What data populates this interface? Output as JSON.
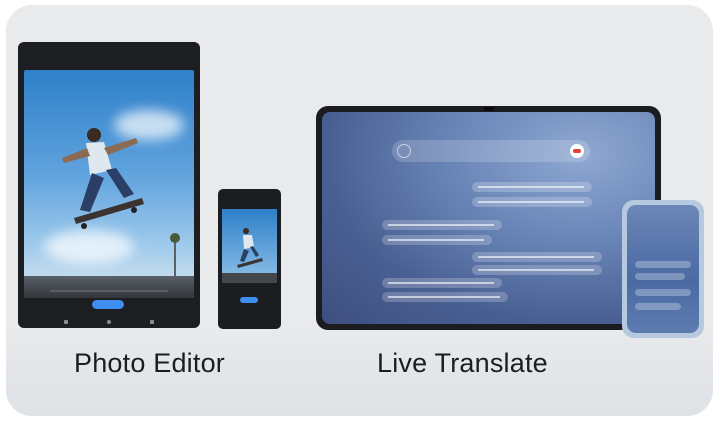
{
  "features": [
    {
      "label": "Photo Editor"
    },
    {
      "label": "Live Translate"
    }
  ],
  "icons": [
    "camera-hole-icon",
    "end-call-icon",
    "back-icon",
    "skateboarder-photo"
  ],
  "colors": {
    "card_bg": "#e8eaec",
    "device_frame": "#1d1e21",
    "accent_blue": "#3d8ef0",
    "end_call_red": "#e2443b"
  }
}
